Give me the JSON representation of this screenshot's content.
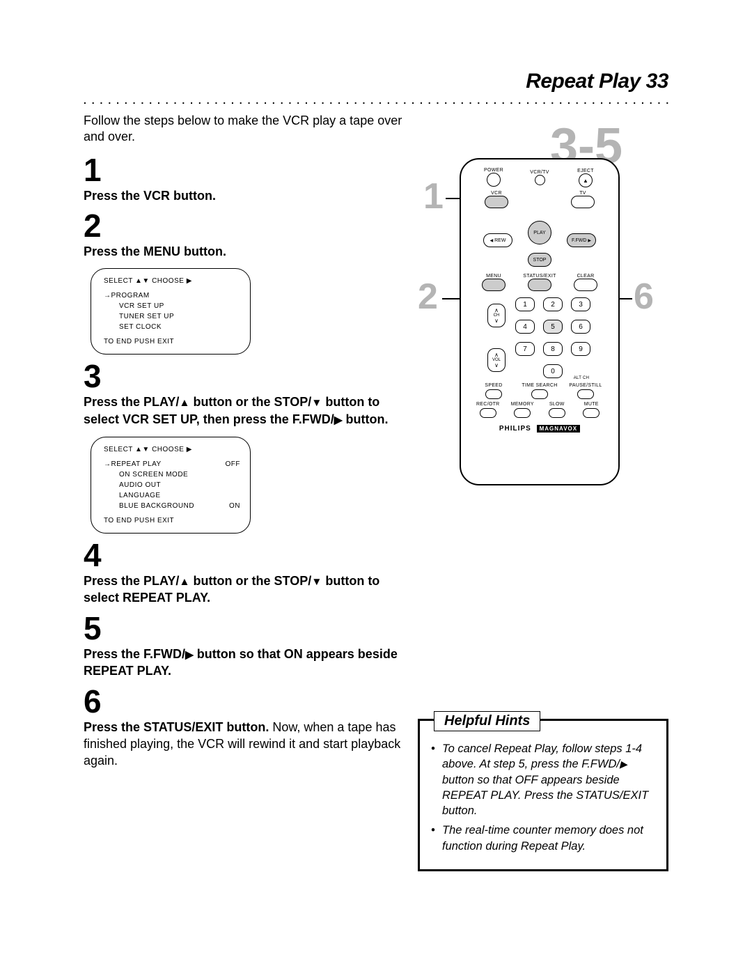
{
  "header": {
    "title": "Repeat Play",
    "page": "33"
  },
  "intro": "Follow the steps below to make the VCR play a tape over and over.",
  "steps": {
    "s1": {
      "num": "1",
      "text": "Press the VCR button."
    },
    "s2": {
      "num": "2",
      "text": "Press the MENU button."
    },
    "s3": {
      "num": "3",
      "prefix": "Press the PLAY/",
      "mid1": " button or the STOP/",
      "mid2": " button to select VCR SET UP, then press the F.FWD/",
      "suffix": " button."
    },
    "s4": {
      "num": "4",
      "prefix": "Press the PLAY/",
      "mid1": " button or the STOP/",
      "mid2": " button to select REPEAT PLAY."
    },
    "s5": {
      "num": "5",
      "prefix": "Press the F.FWD/",
      "suffix": " button so that ON appears beside REPEAT PLAY."
    },
    "s6": {
      "num": "6",
      "bold": "Press the STATUS/EXIT button.",
      "rest": " Now, when a tape has finished playing, the VCR will rewind it and start playback again."
    }
  },
  "osd1": {
    "header": "SELECT ▲▼ CHOOSE ▶",
    "items": [
      "→PROGRAM",
      "VCR SET UP",
      "TUNER SET UP",
      "SET CLOCK"
    ],
    "footer": "TO END PUSH EXIT"
  },
  "osd2": {
    "header": "SELECT ▲▼ CHOOSE ▶",
    "row1": {
      "l": "→REPEAT PLAY",
      "r": "OFF"
    },
    "items": [
      "ON SCREEN MODE",
      "AUDIO OUT",
      "LANGUAGE"
    ],
    "row2": {
      "l": "BLUE BACKGROUND",
      "r": "ON"
    },
    "footer": "TO END PUSH EXIT"
  },
  "remote": {
    "row1": [
      "POWER",
      "VCR/TV",
      "EJECT"
    ],
    "eject_glyph": "▲",
    "vcr": "VCR",
    "tv": "TV",
    "play": "PLAY",
    "rew": "REW",
    "ffwd": "F.FWD",
    "stop": "STOP",
    "menu": "MENU",
    "status": "STATUS/EXIT",
    "clear": "CLEAR",
    "keys": [
      "1",
      "2",
      "3",
      "4",
      "5",
      "6",
      "7",
      "8",
      "9",
      "0"
    ],
    "ch": "CH",
    "vol": "VOL",
    "altch": "ALT CH",
    "row_bottom": [
      "SPEED",
      "TIME SEARCH",
      "PAUSE/STILL"
    ],
    "row_bottom2": [
      "REC/OTR",
      "MEMORY",
      "SLOW",
      "MUTE"
    ],
    "brand": "PHILIPS",
    "brand2": "MAGNAVOX",
    "up": "∧",
    "down": "∨",
    "left": "◀",
    "right": "▶"
  },
  "callouts": {
    "c1": "1",
    "c2": "2",
    "c35": "3-5",
    "c6": "6"
  },
  "hints": {
    "title": "Helpful Hints",
    "h1a": "To cancel Repeat Play, follow steps 1-4 above. At step 5, press the F.FWD/",
    "h1b": " button so that OFF appears beside REPEAT PLAY. Press the STATUS/EXIT button.",
    "h2": "The real-time counter memory does not function during Repeat Play."
  }
}
